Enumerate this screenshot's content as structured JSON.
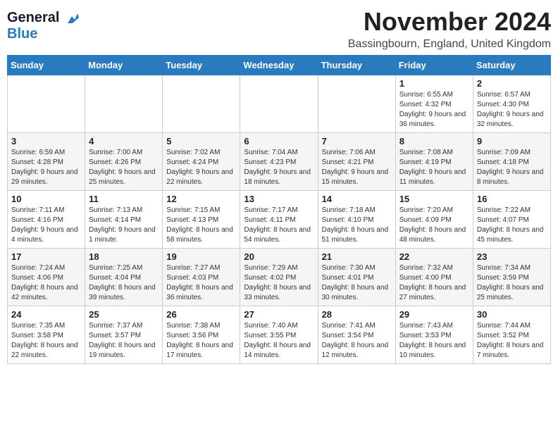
{
  "logo": {
    "line1": "General",
    "line2": "Blue"
  },
  "title": "November 2024",
  "location": "Bassingbourn, England, United Kingdom",
  "days_of_week": [
    "Sunday",
    "Monday",
    "Tuesday",
    "Wednesday",
    "Thursday",
    "Friday",
    "Saturday"
  ],
  "weeks": [
    [
      {
        "day": "",
        "info": ""
      },
      {
        "day": "",
        "info": ""
      },
      {
        "day": "",
        "info": ""
      },
      {
        "day": "",
        "info": ""
      },
      {
        "day": "",
        "info": ""
      },
      {
        "day": "1",
        "info": "Sunrise: 6:55 AM\nSunset: 4:32 PM\nDaylight: 9 hours and 36 minutes."
      },
      {
        "day": "2",
        "info": "Sunrise: 6:57 AM\nSunset: 4:30 PM\nDaylight: 9 hours and 32 minutes."
      }
    ],
    [
      {
        "day": "3",
        "info": "Sunrise: 6:59 AM\nSunset: 4:28 PM\nDaylight: 9 hours and 29 minutes."
      },
      {
        "day": "4",
        "info": "Sunrise: 7:00 AM\nSunset: 4:26 PM\nDaylight: 9 hours and 25 minutes."
      },
      {
        "day": "5",
        "info": "Sunrise: 7:02 AM\nSunset: 4:24 PM\nDaylight: 9 hours and 22 minutes."
      },
      {
        "day": "6",
        "info": "Sunrise: 7:04 AM\nSunset: 4:23 PM\nDaylight: 9 hours and 18 minutes."
      },
      {
        "day": "7",
        "info": "Sunrise: 7:06 AM\nSunset: 4:21 PM\nDaylight: 9 hours and 15 minutes."
      },
      {
        "day": "8",
        "info": "Sunrise: 7:08 AM\nSunset: 4:19 PM\nDaylight: 9 hours and 11 minutes."
      },
      {
        "day": "9",
        "info": "Sunrise: 7:09 AM\nSunset: 4:18 PM\nDaylight: 9 hours and 8 minutes."
      }
    ],
    [
      {
        "day": "10",
        "info": "Sunrise: 7:11 AM\nSunset: 4:16 PM\nDaylight: 9 hours and 4 minutes."
      },
      {
        "day": "11",
        "info": "Sunrise: 7:13 AM\nSunset: 4:14 PM\nDaylight: 9 hours and 1 minute."
      },
      {
        "day": "12",
        "info": "Sunrise: 7:15 AM\nSunset: 4:13 PM\nDaylight: 8 hours and 58 minutes."
      },
      {
        "day": "13",
        "info": "Sunrise: 7:17 AM\nSunset: 4:11 PM\nDaylight: 8 hours and 54 minutes."
      },
      {
        "day": "14",
        "info": "Sunrise: 7:18 AM\nSunset: 4:10 PM\nDaylight: 8 hours and 51 minutes."
      },
      {
        "day": "15",
        "info": "Sunrise: 7:20 AM\nSunset: 4:09 PM\nDaylight: 8 hours and 48 minutes."
      },
      {
        "day": "16",
        "info": "Sunrise: 7:22 AM\nSunset: 4:07 PM\nDaylight: 8 hours and 45 minutes."
      }
    ],
    [
      {
        "day": "17",
        "info": "Sunrise: 7:24 AM\nSunset: 4:06 PM\nDaylight: 8 hours and 42 minutes."
      },
      {
        "day": "18",
        "info": "Sunrise: 7:25 AM\nSunset: 4:04 PM\nDaylight: 8 hours and 39 minutes."
      },
      {
        "day": "19",
        "info": "Sunrise: 7:27 AM\nSunset: 4:03 PM\nDaylight: 8 hours and 36 minutes."
      },
      {
        "day": "20",
        "info": "Sunrise: 7:29 AM\nSunset: 4:02 PM\nDaylight: 8 hours and 33 minutes."
      },
      {
        "day": "21",
        "info": "Sunrise: 7:30 AM\nSunset: 4:01 PM\nDaylight: 8 hours and 30 minutes."
      },
      {
        "day": "22",
        "info": "Sunrise: 7:32 AM\nSunset: 4:00 PM\nDaylight: 8 hours and 27 minutes."
      },
      {
        "day": "23",
        "info": "Sunrise: 7:34 AM\nSunset: 3:59 PM\nDaylight: 8 hours and 25 minutes."
      }
    ],
    [
      {
        "day": "24",
        "info": "Sunrise: 7:35 AM\nSunset: 3:58 PM\nDaylight: 8 hours and 22 minutes."
      },
      {
        "day": "25",
        "info": "Sunrise: 7:37 AM\nSunset: 3:57 PM\nDaylight: 8 hours and 19 minutes."
      },
      {
        "day": "26",
        "info": "Sunrise: 7:38 AM\nSunset: 3:56 PM\nDaylight: 8 hours and 17 minutes."
      },
      {
        "day": "27",
        "info": "Sunrise: 7:40 AM\nSunset: 3:55 PM\nDaylight: 8 hours and 14 minutes."
      },
      {
        "day": "28",
        "info": "Sunrise: 7:41 AM\nSunset: 3:54 PM\nDaylight: 8 hours and 12 minutes."
      },
      {
        "day": "29",
        "info": "Sunrise: 7:43 AM\nSunset: 3:53 PM\nDaylight: 8 hours and 10 minutes."
      },
      {
        "day": "30",
        "info": "Sunrise: 7:44 AM\nSunset: 3:52 PM\nDaylight: 8 hours and 7 minutes."
      }
    ]
  ]
}
